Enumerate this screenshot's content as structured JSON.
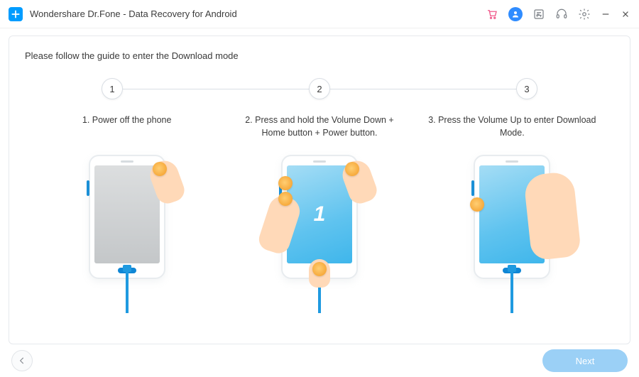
{
  "titlebar": {
    "title": "Wondershare Dr.Fone - Data Recovery for Android"
  },
  "content": {
    "instruction": "Please follow the guide to enter the Download mode",
    "step_numbers": [
      "1",
      "2",
      "3"
    ],
    "steps": [
      {
        "label": "1. Power off the phone"
      },
      {
        "label": "2. Press and hold the Volume Down + Home button + Power button."
      },
      {
        "label": "3. Press the Volume Up to enter Download Mode."
      }
    ],
    "screen_number": "1"
  },
  "footer": {
    "next_label": "Next"
  }
}
